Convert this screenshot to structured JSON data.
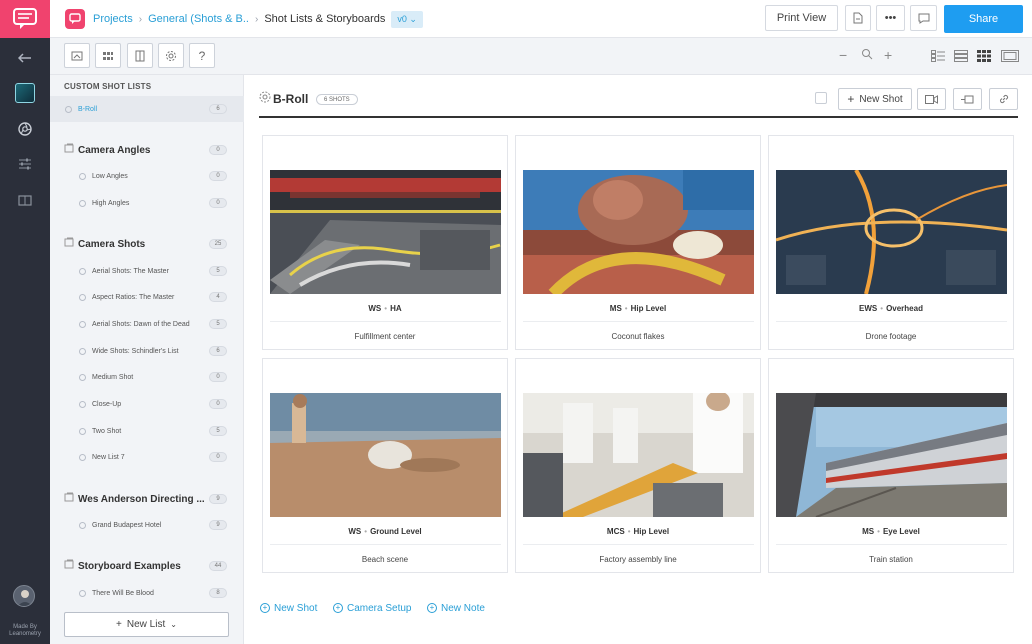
{
  "topbar": {
    "crumbs": [
      "Projects",
      "General (Shots & B..",
      "Shot Lists & Storyboards"
    ],
    "version": "v0",
    "print_view": "Print View",
    "share": "Share"
  },
  "sidebar": {
    "heading": "CUSTOM SHOT LISTS",
    "selected": {
      "label": "B-Roll",
      "count": "6"
    },
    "groups": [
      {
        "label": "Camera Angles",
        "count": "0",
        "items": [
          {
            "label": "Low Angles",
            "count": "0"
          },
          {
            "label": "High Angles",
            "count": "0"
          }
        ]
      },
      {
        "label": "Camera Shots",
        "count": "25",
        "items": [
          {
            "label": "Aerial Shots: The Master",
            "count": "5"
          },
          {
            "label": "Aspect Ratios: The Master",
            "count": "4"
          },
          {
            "label": "Aerial Shots: Dawn of the Dead",
            "count": "5"
          },
          {
            "label": "Wide Shots: Schindler's List",
            "count": "6"
          },
          {
            "label": "Medium Shot",
            "count": "0"
          },
          {
            "label": "Close-Up",
            "count": "0"
          },
          {
            "label": "Two Shot",
            "count": "5"
          },
          {
            "label": "New List 7",
            "count": "0"
          }
        ]
      },
      {
        "label": "Wes Anderson Directing ...",
        "count": "9",
        "items": [
          {
            "label": "Grand Budapest Hotel",
            "count": "9"
          }
        ]
      },
      {
        "label": "Storyboard Examples",
        "count": "44",
        "items": [
          {
            "label": "There Will Be Blood",
            "count": "8"
          }
        ]
      }
    ],
    "new_list": "New List",
    "made_by": [
      "Made By",
      "Leanometry"
    ]
  },
  "main": {
    "title": "B-Roll",
    "shots_badge": "6 SHOTS",
    "new_shot": "New Shot",
    "cards": [
      {
        "size": "WS",
        "angle": "HA",
        "desc": "Fulfillment center"
      },
      {
        "size": "MS",
        "angle": "Hip Level",
        "desc": "Coconut flakes"
      },
      {
        "size": "EWS",
        "angle": "Overhead",
        "desc": "Drone footage"
      },
      {
        "size": "WS",
        "angle": "Ground Level",
        "desc": "Beach scene"
      },
      {
        "size": "MCS",
        "angle": "Hip Level",
        "desc": "Factory assembly line"
      },
      {
        "size": "MS",
        "angle": "Eye Level",
        "desc": "Train station"
      }
    ],
    "add_actions": [
      "New Shot",
      "Camera Setup",
      "New Note"
    ]
  },
  "colors": {
    "accent": "#1e9df1",
    "brand": "#f0436e",
    "link": "#2a9fd6",
    "rail": "#2b2f3a"
  }
}
